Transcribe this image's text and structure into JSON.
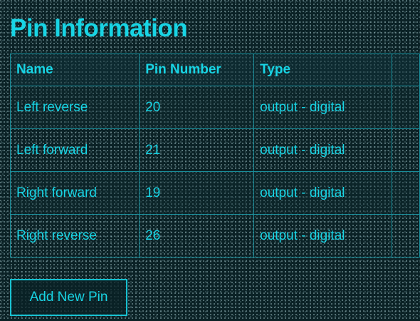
{
  "page": {
    "title": "Pin Information"
  },
  "table": {
    "headers": [
      "Name",
      "Pin Number",
      "Type",
      ""
    ],
    "rows": [
      {
        "name": "Left reverse",
        "pin": "20",
        "type": "output - digital"
      },
      {
        "name": "Left forward",
        "pin": "21",
        "type": "output - digital"
      },
      {
        "name": "Right forward",
        "pin": "19",
        "type": "output - digital"
      },
      {
        "name": "Right reverse",
        "pin": "26",
        "type": "output - digital"
      }
    ]
  },
  "actions": {
    "add_label": "Add New Pin"
  },
  "colors": {
    "accent": "#18d4e4",
    "border": "#1a8f9c",
    "background": "#0b2226"
  }
}
